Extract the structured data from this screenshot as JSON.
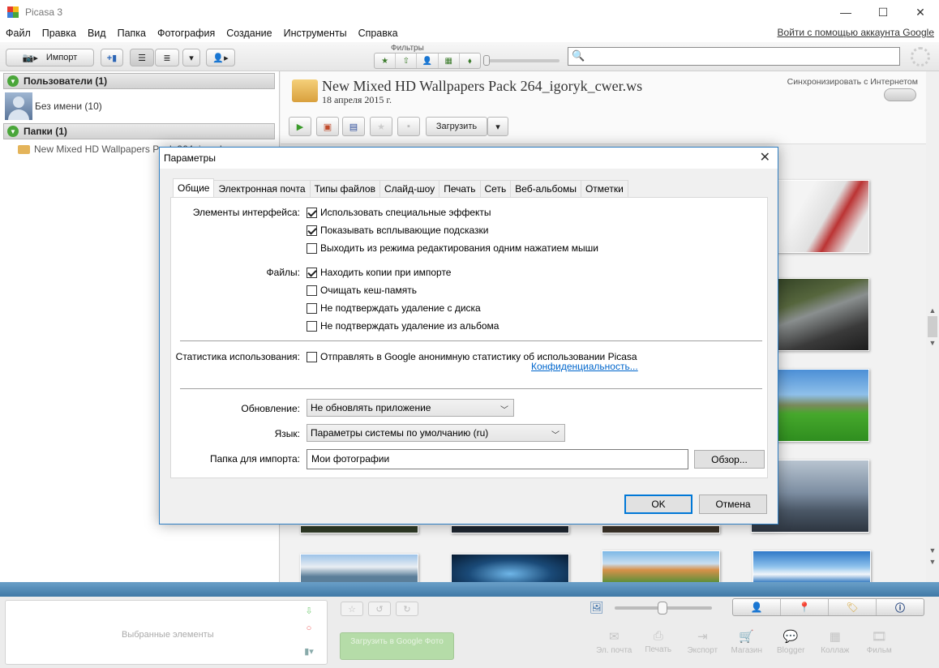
{
  "window": {
    "title": "Picasa 3",
    "controls": {
      "minimize": "—",
      "maximize": "☐",
      "close": "✕"
    }
  },
  "menu": {
    "items": [
      "Файл",
      "Правка",
      "Вид",
      "Папка",
      "Фотография",
      "Создание",
      "Инструменты",
      "Справка"
    ],
    "signin": "Войти с помощью аккаунта Google"
  },
  "toolbar": {
    "import_label": "Импорт",
    "filters_label": "Фильтры",
    "search_placeholder": ""
  },
  "left_panel": {
    "users_header": "Пользователи (1)",
    "user_name": "Без имени (10)",
    "folders_header": "Папки (1)",
    "folder_name": "New Mixed HD Wallpapers Pack 264_igoryk_cwer.ws"
  },
  "album": {
    "title": "New Mixed HD Wallpapers Pack 264_igoryk_cwer.ws",
    "date": "18 апреля 2015 г.",
    "sync_label": "Синхронизировать с Интернетом",
    "upload_label": "Загрузить"
  },
  "tray": {
    "selected_label": "Выбранные элементы",
    "upload_google": "Загрузить в Google Фото",
    "share_buttons": [
      {
        "label": "Эл. почта",
        "icon": "envelope-icon"
      },
      {
        "label": "Печать",
        "icon": "printer-icon"
      },
      {
        "label": "Экспорт",
        "icon": "export-icon"
      },
      {
        "label": "Магазин",
        "icon": "cart-icon"
      },
      {
        "label": "Blogger",
        "icon": "speech-icon"
      },
      {
        "label": "Коллаж",
        "icon": "collage-icon"
      },
      {
        "label": "Фильм",
        "icon": "film-icon"
      }
    ]
  },
  "dialog": {
    "title": "Параметры",
    "close": "✕",
    "tabs": [
      "Общие",
      "Электронная почта",
      "Типы файлов",
      "Слайд-шоу",
      "Печать",
      "Сеть",
      "Веб-альбомы",
      "Отметки"
    ],
    "active_tab": "Общие",
    "ui_label": "Элементы интерфейса:",
    "ui_options": [
      {
        "label": "Использовать специальные эффекты",
        "checked": true
      },
      {
        "label": "Показывать всплывающие подсказки",
        "checked": true
      },
      {
        "label": "Выходить из режима редактирования одним нажатием мыши",
        "checked": false
      }
    ],
    "files_label": "Файлы:",
    "files_options": [
      {
        "label": "Находить копии при импорте",
        "checked": true
      },
      {
        "label": "Очищать кеш-память",
        "checked": false
      },
      {
        "label": "Не подтверждать удаление с диска",
        "checked": false
      },
      {
        "label": "Не подтверждать удаление из альбома",
        "checked": false
      }
    ],
    "stats_label": "Статистика использования:",
    "stats_option": {
      "label": "Отправлять в Google анонимную статистику об использовании Picasa",
      "checked": false
    },
    "privacy_link": "Конфиденциальность...",
    "update_label": "Обновление:",
    "update_value": "Не обновлять приложение",
    "language_label": "Язык:",
    "language_value": "Параметры системы по умолчанию (ru)",
    "import_folder_label": "Папка для импорта:",
    "import_folder_value": "Мои фотографии",
    "browse": "Обзор...",
    "ok": "OK",
    "cancel": "Отмена"
  },
  "colors": {
    "dialog_border": "#2f7fc4",
    "divider": "#4a85b3",
    "checkbox_green": "#4aa63a"
  }
}
